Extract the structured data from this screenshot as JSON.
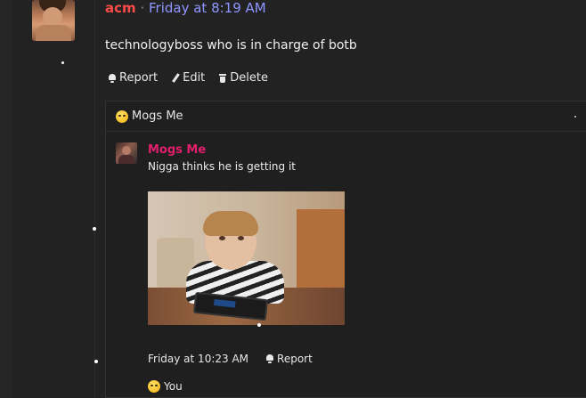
{
  "post": {
    "username": "acm",
    "separator": "·",
    "timestamp": "Friday at 8:19 AM",
    "message": "technologyboss who is in charge of botb",
    "actions": {
      "report": "Report",
      "edit": "Edit",
      "delete": "Delete"
    }
  },
  "reply": {
    "header_author": "Mogs Me",
    "author": "Mogs Me",
    "text": "Nigga thinks he is getting it",
    "timestamp": "Friday at 10:23 AM",
    "report": "Report",
    "reaction_user": "You"
  },
  "colors": {
    "username": "#ff4a4a",
    "timestamp": "#8f96ff",
    "reply_author": "#e21f6a"
  }
}
